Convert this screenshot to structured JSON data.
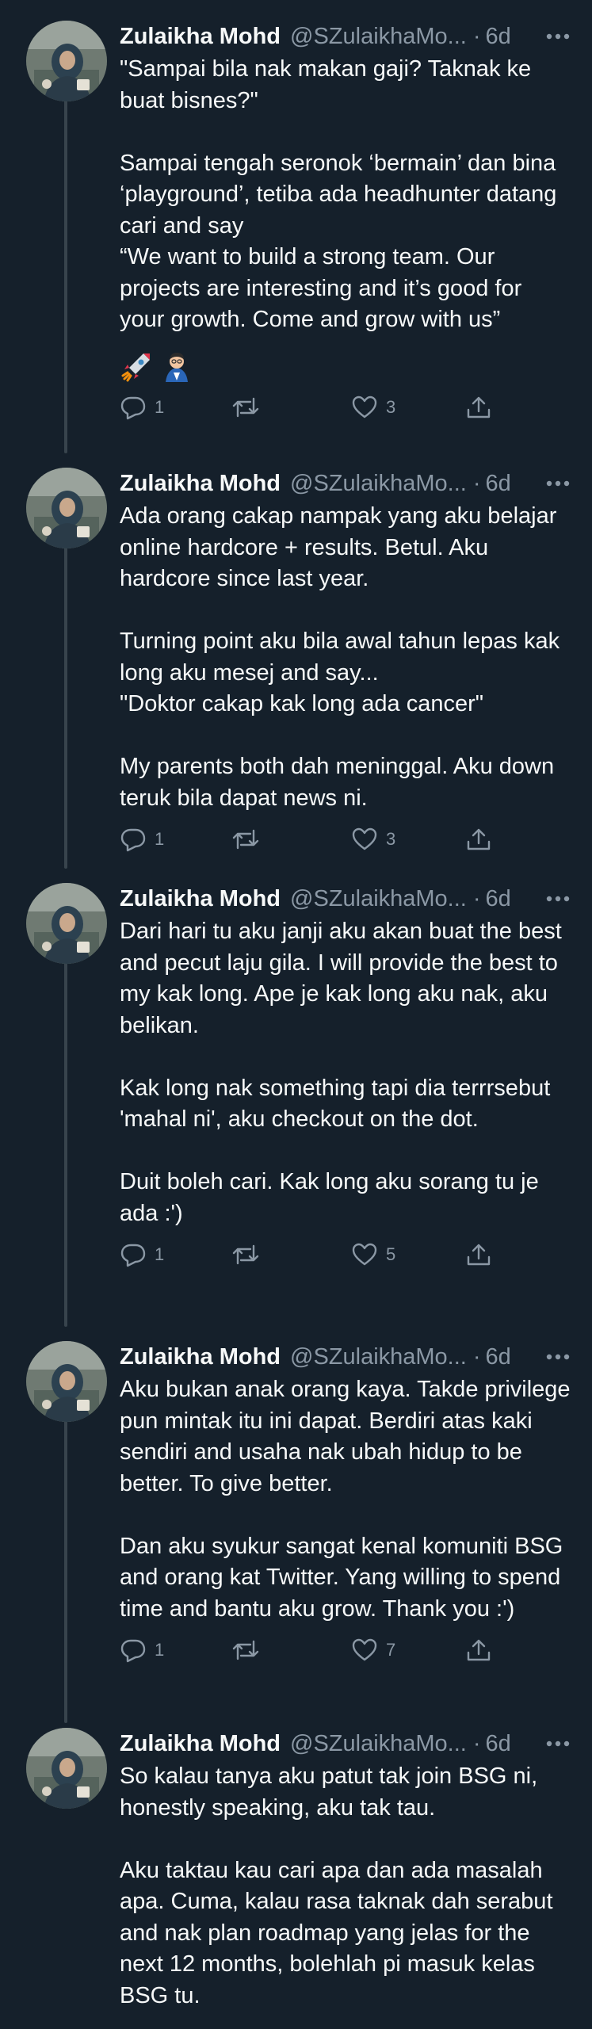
{
  "author": {
    "display_name": "Zulaikha Mohd",
    "handle": "@SZulaikhaMo...",
    "separator": "·"
  },
  "colors": {
    "background": "#15202b",
    "text": "#f7f9f9",
    "secondary": "#8b98a5",
    "thread_line": "#38444d"
  },
  "tweets": [
    {
      "time": "6d",
      "text": "\"Sampai bila nak makan gaji? Taknak ke buat bisnes?\"\n\nSampai tengah seronok ‘bermain’ dan bina ‘playground’, tetiba ada headhunter datang cari and say\n“We want to build a strong team. Our projects are interesting and it’s good for your growth. Come and grow with us”",
      "emojis": [
        "rocket",
        "scientist"
      ],
      "replies": "1",
      "retweets": "",
      "likes": "3"
    },
    {
      "time": "6d",
      "text": "Ada orang cakap nampak yang aku belajar online hardcore + results. Betul. Aku hardcore since last year.\n\nTurning point aku bila awal tahun lepas kak long aku mesej and say...\n\"Doktor cakap kak long ada cancer\"\n\nMy parents both dah meninggal. Aku down teruk bila dapat news ni.",
      "replies": "1",
      "retweets": "",
      "likes": "3"
    },
    {
      "time": "6d",
      "text": "Dari hari tu aku janji aku akan buat the best and pecut laju gila. I will provide the best to my kak long. Ape je kak long aku nak, aku belikan.\n\nKak long nak something tapi dia terrrsebut 'mahal ni', aku checkout on the dot.\n\nDuit boleh cari. Kak long aku sorang tu je ada :')",
      "replies": "1",
      "retweets": "",
      "likes": "5"
    },
    {
      "time": "6d",
      "text": "Aku bukan anak orang kaya. Takde privilege pun mintak itu ini dapat. Berdiri atas kaki sendiri and usaha nak ubah hidup to be better. To give better.\n\nDan aku syukur sangat kenal komuniti BSG and orang kat Twitter. Yang willing to spend time and bantu aku grow. Thank you :')",
      "replies": "1",
      "retweets": "",
      "likes": "7"
    },
    {
      "time": "6d",
      "text": "So kalau tanya aku patut tak join BSG ni, honestly speaking, aku tak tau.\n\nAku taktau kau cari apa dan ada masalah apa. Cuma, kalau rasa taknak dah serabut and nak plan roadmap yang jelas for the next 12 months, bolehlah pi masuk kelas BSG tu."
    }
  ]
}
